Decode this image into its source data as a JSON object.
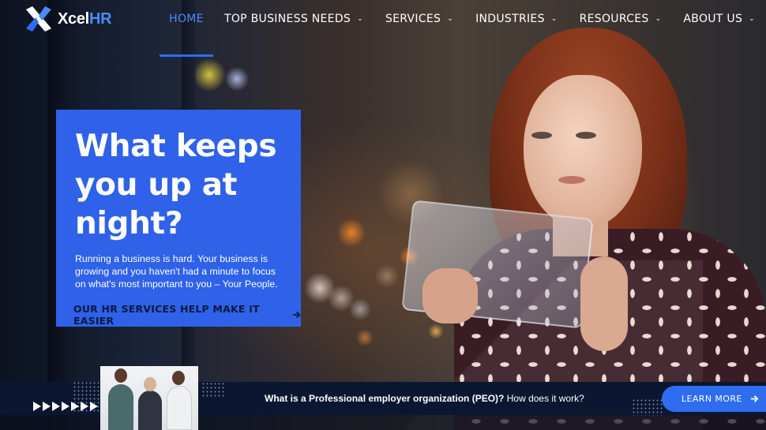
{
  "brand": {
    "name_main": "Xcel",
    "name_accent": "HR"
  },
  "nav": {
    "items": [
      {
        "label": "HOME",
        "active": true,
        "dropdown": false
      },
      {
        "label": "TOP BUSINESS NEEDS",
        "active": false,
        "dropdown": true
      },
      {
        "label": "SERVICES",
        "active": false,
        "dropdown": true
      },
      {
        "label": "INDUSTRIES",
        "active": false,
        "dropdown": true
      },
      {
        "label": "RESOURCES",
        "active": false,
        "dropdown": true
      },
      {
        "label": "ABOUT US",
        "active": false,
        "dropdown": true
      }
    ]
  },
  "hero": {
    "title": "What keeps you up at night?",
    "body": "Running a business is hard. Your business is growing and you haven't had a minute to focus on what's most important to you – Your People.",
    "cta": "OUR HR SERVICES HELP MAKE IT EASIER"
  },
  "banner": {
    "question_bold": "What is a Professional employer organization (PEO)?",
    "question_rest": " How does it work?",
    "button_label": "LEARN MORE"
  },
  "colors": {
    "accent": "#2f6df0",
    "hero_card": "#2f62e8",
    "banner_bg": "#0b1730"
  },
  "icons": {
    "logo": "x-logo-icon",
    "dropdown": "chevron-down-icon",
    "cta_arrow": "arrow-right-icon",
    "play": "play-triangle-icon"
  }
}
